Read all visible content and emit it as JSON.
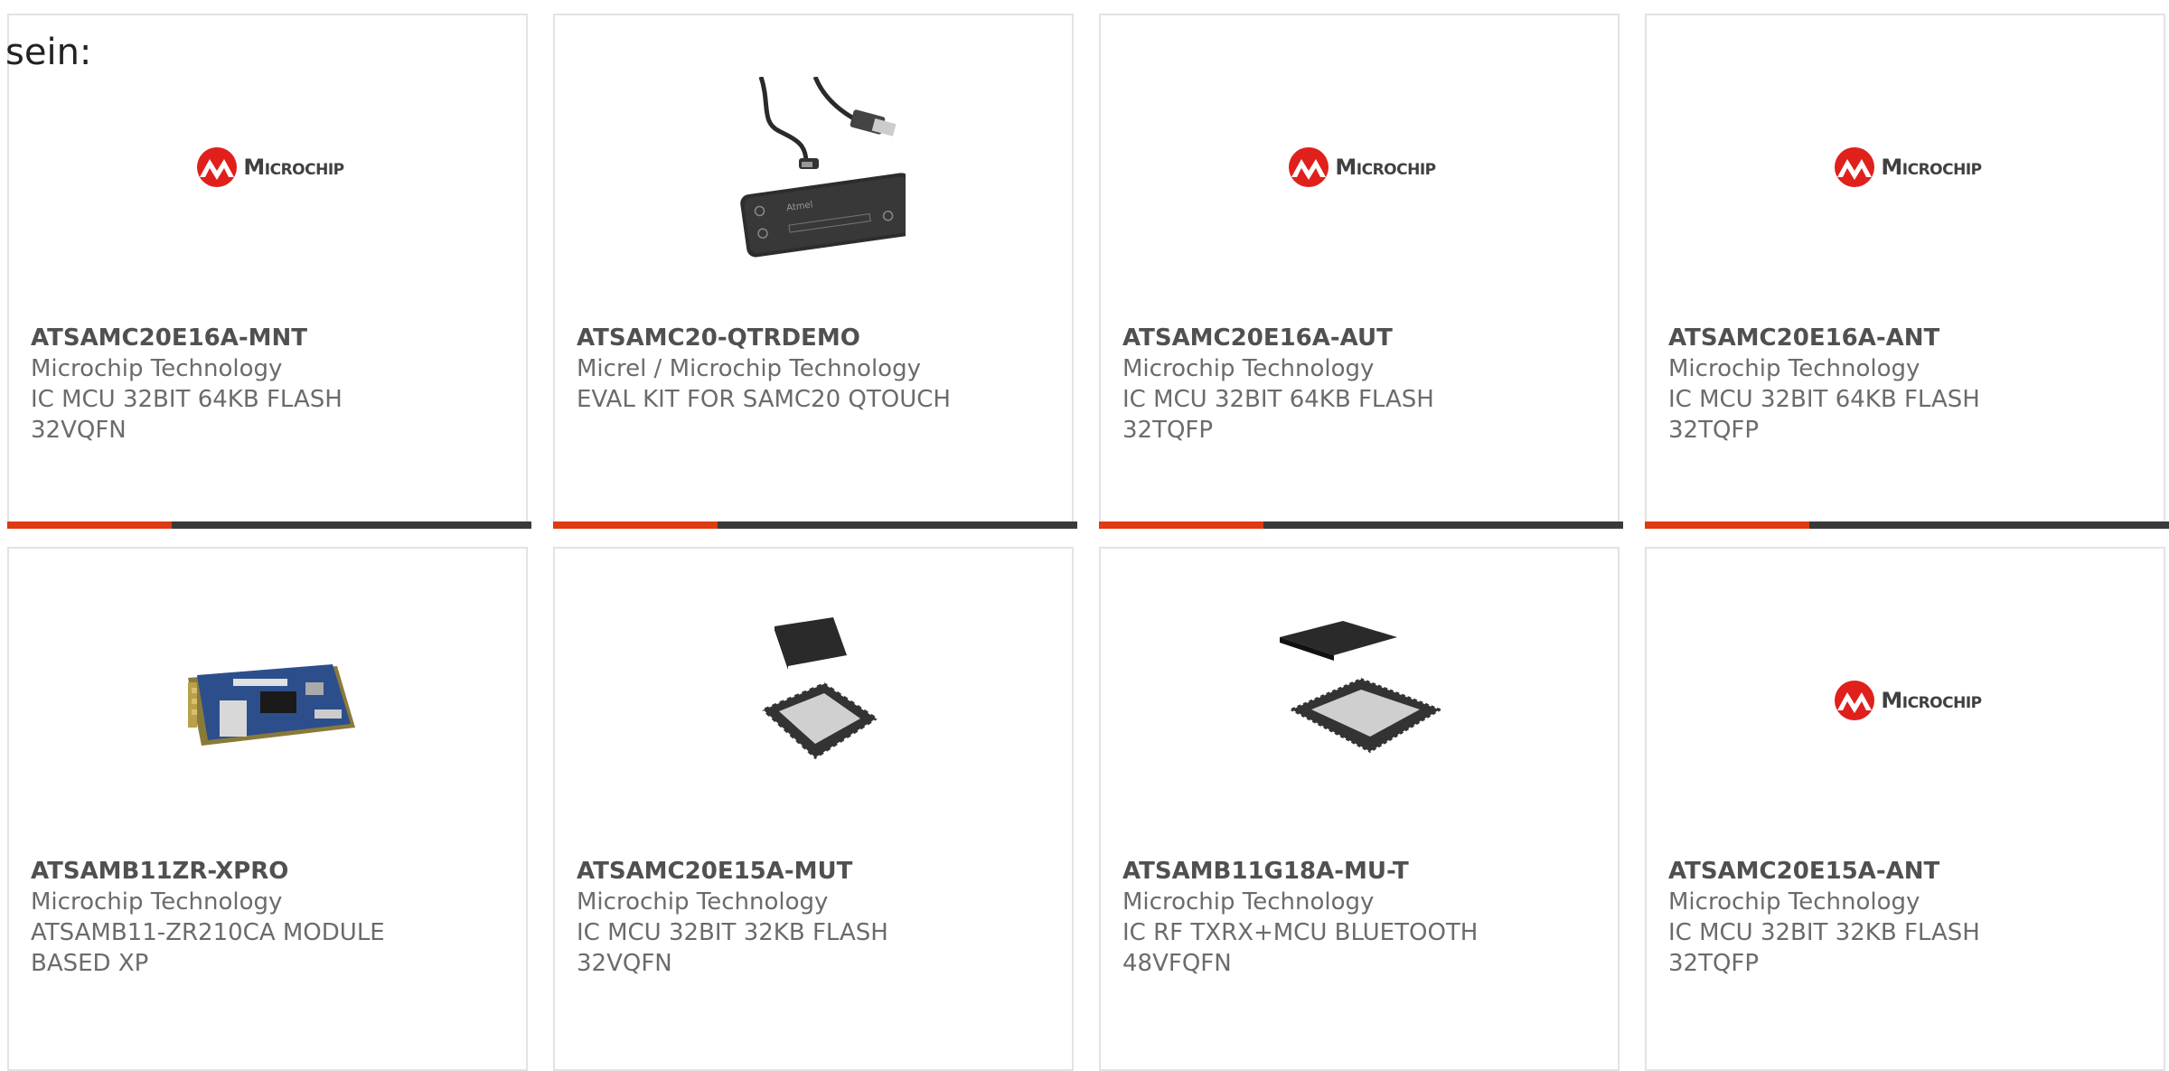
{
  "heading": "sein:",
  "colors": {
    "accent": "#e03a12",
    "bar": "#3a3a3a",
    "brand_red": "#e0201b"
  },
  "cards": [
    {
      "part": "ATSAMC20E16A-MNT",
      "manufacturer": "Microchip Technology",
      "desc1": "IC MCU 32BIT 64KB FLASH",
      "desc2": "32VQFN",
      "image": "microchip-logo",
      "logo_text": "Microchip"
    },
    {
      "part": "ATSAMC20-QTRDEMO",
      "manufacturer": "Micrel / Microchip Technology",
      "desc1": "EVAL KIT FOR SAMC20 QTOUCH",
      "desc2": "",
      "image": "eval-kit-photo"
    },
    {
      "part": "ATSAMC20E16A-AUT",
      "manufacturer": "Microchip Technology",
      "desc1": "IC MCU 32BIT 64KB FLASH",
      "desc2": "32TQFP",
      "image": "microchip-logo",
      "logo_text": "Microchip"
    },
    {
      "part": "ATSAMC20E16A-ANT",
      "manufacturer": "Microchip Technology",
      "desc1": "IC MCU 32BIT 64KB FLASH",
      "desc2": "32TQFP",
      "image": "microchip-logo",
      "logo_text": "Microchip"
    },
    {
      "part": "ATSAMB11ZR-XPRO",
      "manufacturer": "Microchip Technology",
      "desc1": "ATSAMB11-ZR210CA MODULE",
      "desc2": "BASED XP",
      "image": "dev-board-photo"
    },
    {
      "part": "ATSAMC20E15A-MUT",
      "manufacturer": "Microchip Technology",
      "desc1": "IC MCU 32BIT 32KB FLASH",
      "desc2": "32VQFN",
      "image": "qfn-chip-photo"
    },
    {
      "part": "ATSAMB11G18A-MU-T",
      "manufacturer": "Microchip Technology",
      "desc1": "IC RF TXRX+MCU BLUETOOTH",
      "desc2": "48VFQFN",
      "image": "qfn48-chip-photo"
    },
    {
      "part": "ATSAMC20E15A-ANT",
      "manufacturer": "Microchip Technology",
      "desc1": "IC MCU 32BIT 32KB FLASH",
      "desc2": "32TQFP",
      "image": "microchip-logo",
      "logo_text": "Microchip"
    }
  ]
}
